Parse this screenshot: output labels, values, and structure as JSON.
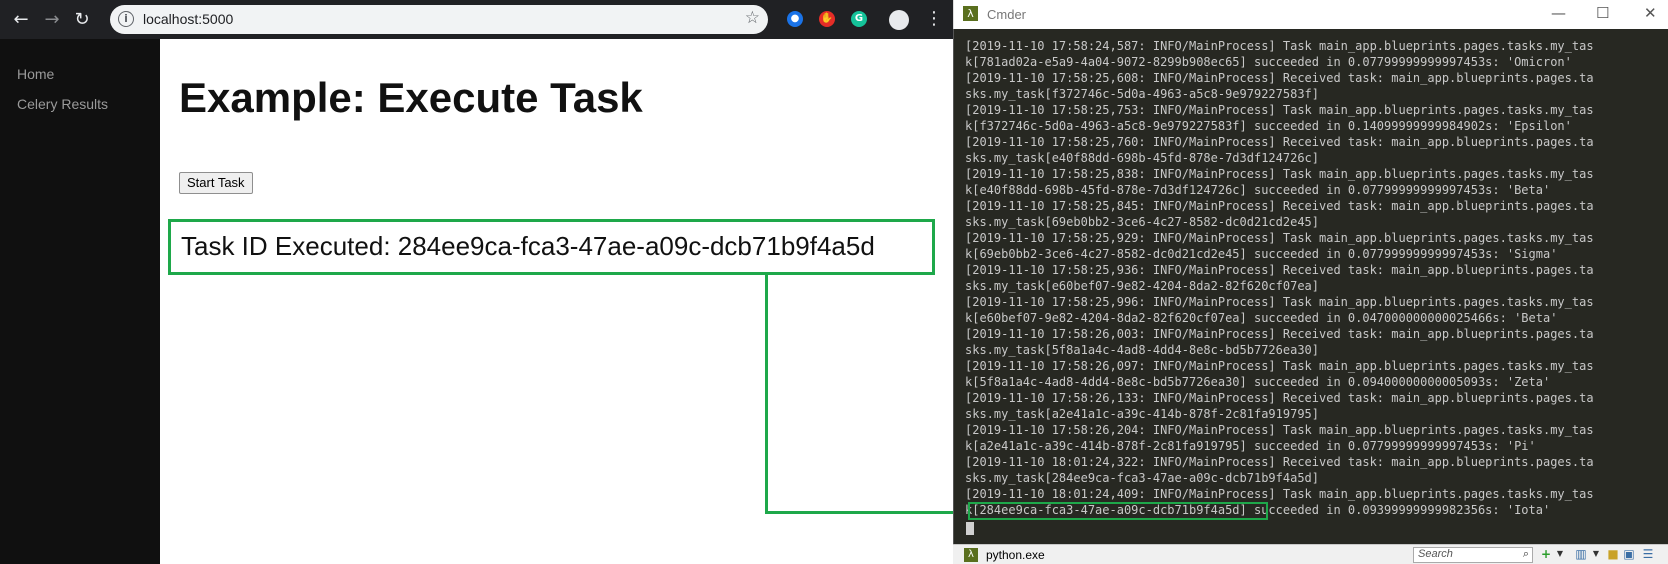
{
  "browser": {
    "url": "localhost:5000",
    "sidebar": {
      "items": [
        {
          "label": "Home"
        },
        {
          "label": "Celery Results"
        }
      ]
    },
    "page": {
      "title": "Example: Execute Task",
      "start_button": "Start Task",
      "task_result": "Task ID Executed: 284ee9ca-fca3-47ae-a09c-dcb71b9f4a5d"
    }
  },
  "cmder": {
    "title": "Cmder",
    "log_lines": [
      "[2019-11-10 17:58:24,587: INFO/MainProcess] Task main_app.blueprints.pages.tasks.my_tas",
      "k[781ad02a-e5a9-4a04-9072-8299b908ec65] succeeded in 0.07799999999997453s: 'Omicron'",
      "[2019-11-10 17:58:25,608: INFO/MainProcess] Received task: main_app.blueprints.pages.ta",
      "sks.my_task[f372746c-5d0a-4963-a5c8-9e979227583f]",
      "[2019-11-10 17:58:25,753: INFO/MainProcess] Task main_app.blueprints.pages.tasks.my_tas",
      "k[f372746c-5d0a-4963-a5c8-9e979227583f] succeeded in 0.14099999999984902s: 'Epsilon'",
      "[2019-11-10 17:58:25,760: INFO/MainProcess] Received task: main_app.blueprints.pages.ta",
      "sks.my_task[e40f88dd-698b-45fd-878e-7d3df124726c]",
      "[2019-11-10 17:58:25,838: INFO/MainProcess] Task main_app.blueprints.pages.tasks.my_tas",
      "k[e40f88dd-698b-45fd-878e-7d3df124726c] succeeded in 0.07799999999997453s: 'Beta'",
      "[2019-11-10 17:58:25,845: INFO/MainProcess] Received task: main_app.blueprints.pages.ta",
      "sks.my_task[69eb0bb2-3ce6-4c27-8582-dc0d21cd2e45]",
      "[2019-11-10 17:58:25,929: INFO/MainProcess] Task main_app.blueprints.pages.tasks.my_tas",
      "k[69eb0bb2-3ce6-4c27-8582-dc0d21cd2e45] succeeded in 0.07799999999997453s: 'Sigma'",
      "[2019-11-10 17:58:25,936: INFO/MainProcess] Received task: main_app.blueprints.pages.ta",
      "sks.my_task[e60bef07-9e82-4204-8da2-82f620cf07ea]",
      "[2019-11-10 17:58:25,996: INFO/MainProcess] Task main_app.blueprints.pages.tasks.my_tas",
      "k[e60bef07-9e82-4204-8da2-82f620cf07ea] succeeded in 0.047000000000025466s: 'Beta'",
      "[2019-11-10 17:58:26,003: INFO/MainProcess] Received task: main_app.blueprints.pages.ta",
      "sks.my_task[5f8a1a4c-4ad8-4dd4-8e8c-bd5b7726ea30]",
      "[2019-11-10 17:58:26,097: INFO/MainProcess] Task main_app.blueprints.pages.tasks.my_tas",
      "k[5f8a1a4c-4ad8-4dd4-8e8c-bd5b7726ea30] succeeded in 0.09400000000005093s: 'Zeta'",
      "[2019-11-10 17:58:26,133: INFO/MainProcess] Received task: main_app.blueprints.pages.ta",
      "sks.my_task[a2e41a1c-a39c-414b-878f-2c81fa919795]",
      "[2019-11-10 17:58:26,204: INFO/MainProcess] Task main_app.blueprints.pages.tasks.my_tas",
      "k[a2e41a1c-a39c-414b-878f-2c81fa919795] succeeded in 0.07799999999997453s: 'Pi'",
      "[2019-11-10 18:01:24,322: INFO/MainProcess] Received task: main_app.blueprints.pages.ta",
      "sks.my_task[284ee9ca-fca3-47ae-a09c-dcb71b9f4a5d]",
      "[2019-11-10 18:01:24,409: INFO/MainProcess] Task main_app.blueprints.pages.tasks.my_tas",
      "k[284ee9ca-fca3-47ae-a09c-dcb71b9f4a5d] succeeded in 0.09399999999982356s: 'Iota'"
    ],
    "status_tab": "python.exe",
    "search_placeholder": "Search"
  },
  "colors": {
    "highlight": "#1ea84a",
    "terminal_bg": "#272822",
    "sidebar_bg": "#101010"
  },
  "icons": {
    "back": "back-arrow-icon",
    "forward": "forward-arrow-icon",
    "reload": "reload-icon",
    "bookmark": "star-icon",
    "menu": "kebab-menu-icon"
  }
}
